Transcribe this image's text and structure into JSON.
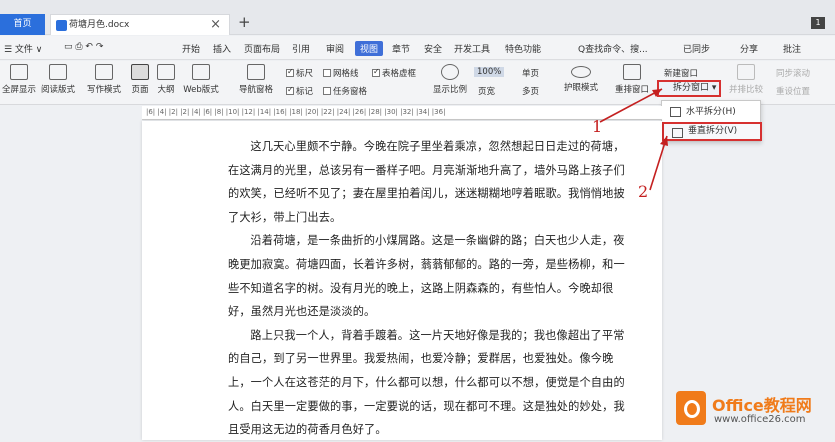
{
  "tabs": {
    "home": "首页",
    "doc": "荷塘月色.docx",
    "close": "×",
    "new": "+",
    "badge": "1"
  },
  "menu": {
    "file": "☰ 文件 ∨",
    "items": [
      "开始",
      "插入",
      "页面布局",
      "引用",
      "审阅",
      "视图",
      "章节",
      "安全",
      "开发工具",
      "特色功能"
    ],
    "search": "Q查找命令、搜...",
    "sync": "已同步",
    "share": "分享",
    "comment": "批注"
  },
  "toolbar": {
    "views": [
      "全屏显示",
      "阅读版式",
      "写作模式",
      "页面",
      "大纲",
      "Web版式"
    ],
    "nav": "导航窗格",
    "ruler": "标尺",
    "grid": "网格线",
    "table_lines": "表格虚框",
    "mark": "标记",
    "task_pane": "任务窗格",
    "zoom_label": "显示比例",
    "zoom_value": "100%",
    "single_page": "单页",
    "page_width": "页宽",
    "multi_page": "多页",
    "eye_mode": "护眼模式",
    "rearrange": "重排窗口",
    "new_window": "新建窗口",
    "split_window": "拆分窗口",
    "side_by_side": "并排比较",
    "sync_scroll": "同步滚动",
    "reset_position": "重设位置"
  },
  "dropdown": {
    "horizontal": "水平拆分(H)",
    "vertical": "垂直拆分(V)"
  },
  "ruler_text": "|6|  |4|  |2|       |2|  |4|  |6|  |8|  |10|  |12|  |14|  |16|  |18|  |20|  |22|  |24|  |26|  |28|  |30|  |32|  |34|  |36|",
  "paragraphs": [
    "这几天心里颇不宁静。今晚在院子里坐着乘凉，忽然想起日日走过的荷塘，在这满月的光里，总该另有一番样子吧。月亮渐渐地升高了，墙外马路上孩子们的欢笑，已经听不见了；妻在屋里拍着闰儿，迷迷糊糊地哼着眠歌。我悄悄地披了大衫，带上门出去。",
    "沿着荷塘，是一条曲折的小煤屑路。这是一条幽僻的路；白天也少人走，夜晚更加寂寞。荷塘四面，长着许多树，蓊蓊郁郁的。路的一旁，是些杨柳，和一些不知道名字的树。没有月光的晚上，这路上阴森森的，有些怕人。今晚却很好，虽然月光也还是淡淡的。",
    "路上只我一个人，背着手踱着。这一片天地好像是我的；我也像超出了平常的自己，到了另一世界里。我爱热闹，也爱冷静；爱群居，也爱独处。像今晚上，一个人在这苍茫的月下，什么都可以想，什么都可以不想，便觉是个自由的人。白天里一定要做的事，一定要说的话，现在都可不理。这是独处的妙处，我且受用这无边的荷香月色好了。"
  ],
  "annotations": {
    "one": "1",
    "two": "2"
  },
  "watermark": {
    "brand": "Office教程网",
    "url": "www.office26.com"
  },
  "colors": {
    "accent": "#2b6fdc",
    "highlight": "#d63030",
    "brand": "#f07b1a"
  }
}
